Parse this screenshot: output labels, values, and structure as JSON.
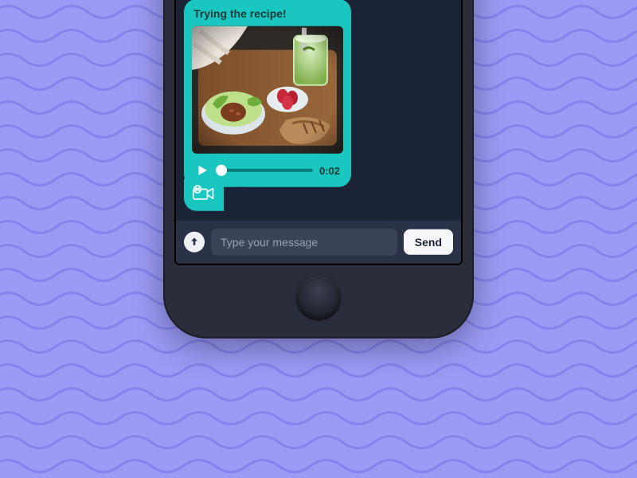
{
  "colors": {
    "accent": "#19c7c0",
    "bg": "#9b9af5",
    "panel": "#1b2437"
  },
  "outgoing": {
    "text": ""
  },
  "message": {
    "caption": "Trying the recipe!",
    "duration": "0:02",
    "attachment": "video"
  },
  "composer": {
    "placeholder": "Type your message",
    "send": "Send"
  }
}
